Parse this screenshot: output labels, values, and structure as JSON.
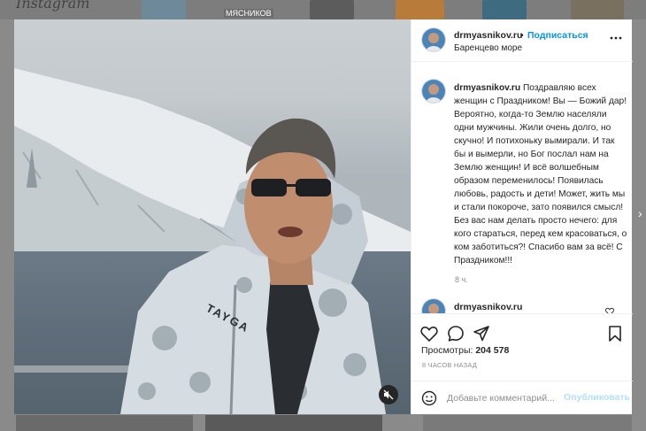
{
  "post": {
    "username": "drmyasnikov.ru",
    "separator": "•",
    "follow_label": "Подписаться",
    "location": "Баренцево море",
    "caption_username": "drmyasnikov.ru",
    "caption_text": "Поздравляю всех женщин с Праздником! Вы — Божий дар! Вероятно, когда-то Землю населяли одни мужчины. Жили очень долго, но скучно! И потихоньку вымирали. И так бы и вымерли, но Бог послал нам на Землю женщин! И всё волшебным образом переменилось! Появилась любовь, радость и дети! Может, жить мы и стали покороче, зато появился смысл! Без вас нам делать просто нечего: для кого стараться, перед кем красоваться, о ком заботиться?! Спасибо вам за всё! С Праздником!!!",
    "caption_time": "8 ч.",
    "comment2_username": "drmyasnikov.ru",
    "views_label": "Просмотры:",
    "views_count": "204 578",
    "posted_ago": "8 ЧАСОВ НАЗАД",
    "comment_placeholder": "Добавьте комментарий...",
    "publish_label": "Опубликовать"
  },
  "background": {
    "logo_text": "Instagram",
    "tag_text": "МЯСНИКОВ"
  },
  "video": {
    "jacket_brand": "TAYGA"
  },
  "icons": {
    "more": "more-horizontal-icon",
    "like": "heart-icon",
    "comment": "comment-icon",
    "share": "paper-plane-icon",
    "save": "bookmark-icon",
    "emoji": "smiley-icon",
    "mute": "speaker-muted-icon"
  },
  "colors": {
    "accent": "#0095f6",
    "publish_disabled": "#b2dffc",
    "text": "#262626",
    "secondary": "#8e8e8e"
  }
}
